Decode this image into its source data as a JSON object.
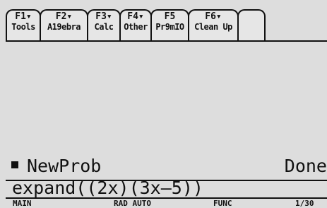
{
  "toolbar": {
    "tools": [
      {
        "key": "F1▾",
        "label": "Tools"
      },
      {
        "key": "F2▾",
        "label": "A19ebra"
      },
      {
        "key": "F3▾",
        "label": "Calc"
      },
      {
        "key": "F4▾",
        "label": "Other"
      },
      {
        "key": "F5",
        "label": "Pr9mIO"
      },
      {
        "key": "F6▾",
        "label": "Clean Up"
      }
    ]
  },
  "history": {
    "entry": "NewProb",
    "result": "Done"
  },
  "entry_line": {
    "value": "expand((2x)(3x–5))"
  },
  "status": {
    "folder": "MAIN",
    "angle": "RAD AUTO",
    "mode": "FUNC",
    "count": "1/30"
  }
}
